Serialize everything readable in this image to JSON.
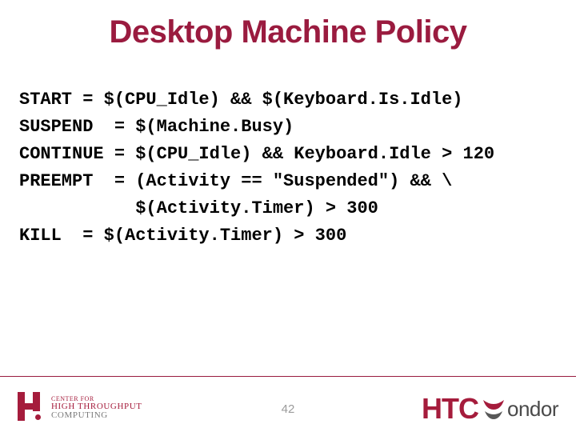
{
  "title": "Desktop Machine Policy",
  "code": {
    "l1": "START = $(CPU_Idle) && $(Keyboard.Is.Idle)",
    "l2": "SUSPEND  = $(Machine.Busy)",
    "l3": "CONTINUE = $(CPU_Idle) && Keyboard.Idle > 120",
    "l4": "PREEMPT  = (Activity == \"Suspended\") && \\",
    "l5": "           $(Activity.Timer) > 300",
    "l6": "KILL  = $(Activity.Timer) > 300"
  },
  "footer": {
    "page_number": "42",
    "left_logo": {
      "line1": "CENTER FOR",
      "line2": "HIGH THROUGHPUT",
      "line3": "COMPUTING"
    },
    "right_logo": {
      "part1": "HTC",
      "part2": "ondor"
    }
  }
}
